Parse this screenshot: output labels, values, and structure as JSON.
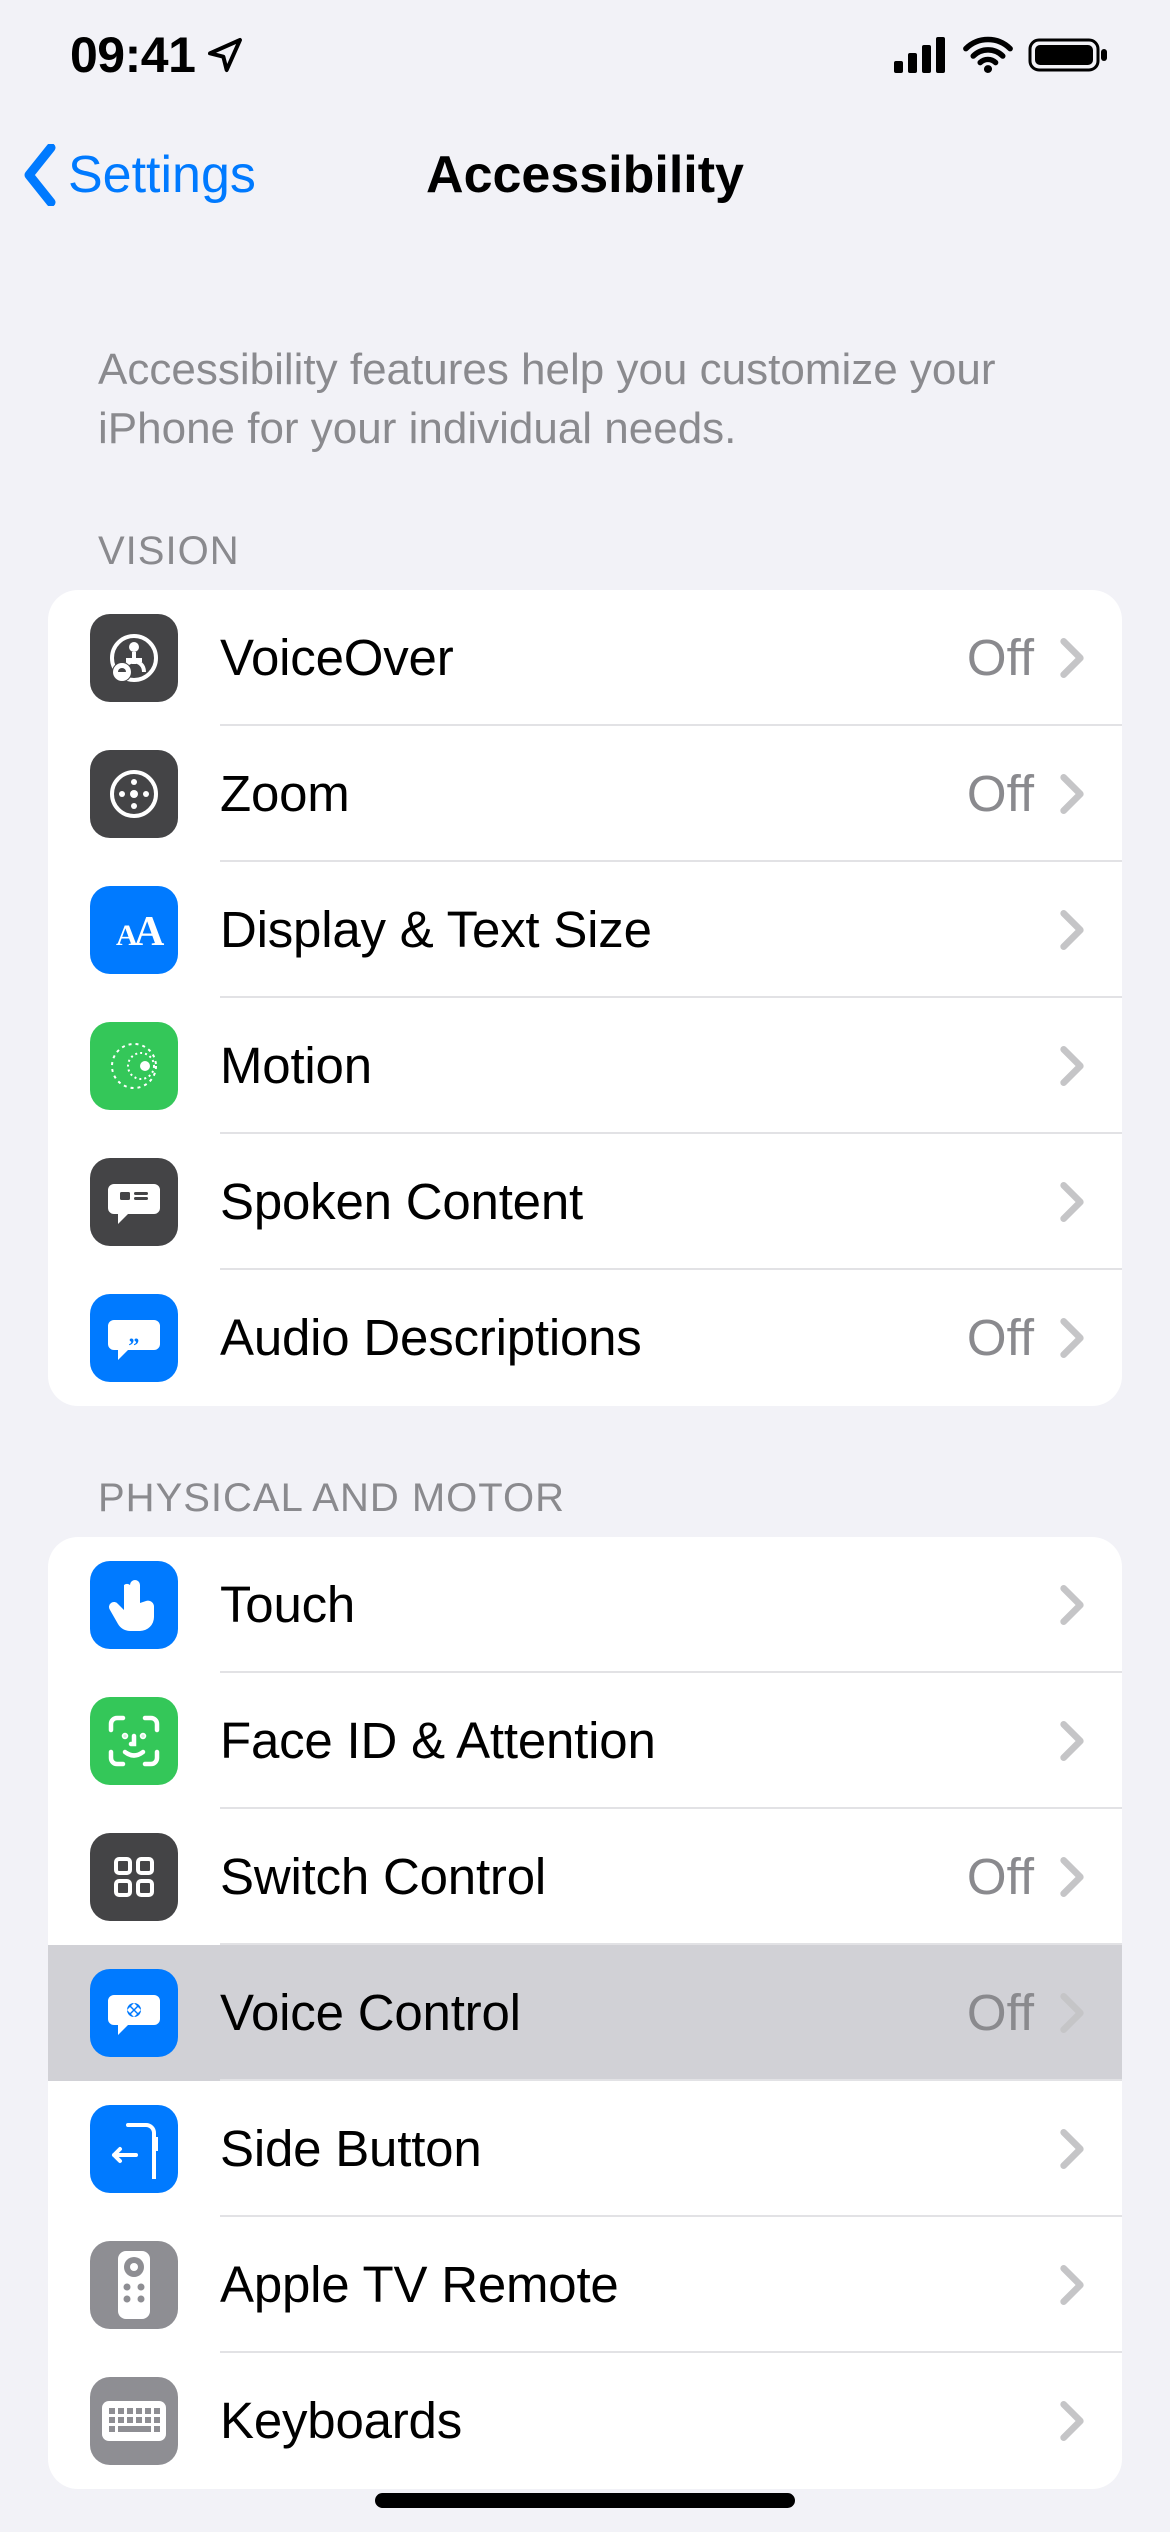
{
  "status": {
    "time": "09:41"
  },
  "nav": {
    "back_label": "Settings",
    "title": "Accessibility"
  },
  "intro": "Accessibility features help you customize your iPhone for your individual needs.",
  "sections": [
    {
      "header": "VISION",
      "rows": [
        {
          "icon": "voiceover-icon",
          "label": "VoiceOver",
          "value": "Off"
        },
        {
          "icon": "zoom-icon",
          "label": "Zoom",
          "value": "Off"
        },
        {
          "icon": "textsize-icon",
          "label": "Display & Text Size",
          "value": ""
        },
        {
          "icon": "motion-icon",
          "label": "Motion",
          "value": ""
        },
        {
          "icon": "spoken-icon",
          "label": "Spoken Content",
          "value": ""
        },
        {
          "icon": "audiodesc-icon",
          "label": "Audio Descriptions",
          "value": "Off"
        }
      ]
    },
    {
      "header": "PHYSICAL AND MOTOR",
      "rows": [
        {
          "icon": "touch-icon",
          "label": "Touch",
          "value": ""
        },
        {
          "icon": "faceid-icon",
          "label": "Face ID & Attention",
          "value": ""
        },
        {
          "icon": "switch-icon",
          "label": "Switch Control",
          "value": "Off"
        },
        {
          "icon": "voicectrl-icon",
          "label": "Voice Control",
          "value": "Off"
        },
        {
          "icon": "sidebutton-icon",
          "label": "Side Button",
          "value": ""
        },
        {
          "icon": "appletv-icon",
          "label": "Apple TV Remote",
          "value": ""
        },
        {
          "icon": "keyboards-icon",
          "label": "Keyboards",
          "value": ""
        }
      ]
    }
  ]
}
